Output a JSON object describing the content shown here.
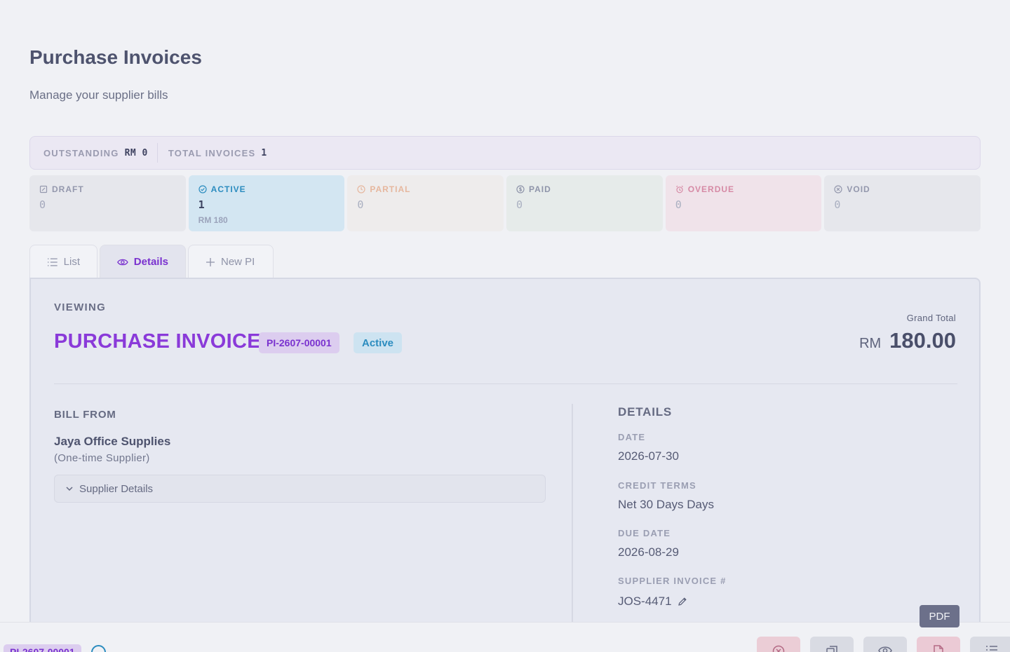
{
  "header": {
    "title": "Purchase Invoices",
    "subtitle": "Manage your supplier bills"
  },
  "summary": {
    "outstanding_label": "OUTSTANDING",
    "outstanding_value": "RM 0",
    "total_label": "TOTAL INVOICES",
    "total_value": "1"
  },
  "status_cards": [
    {
      "label": "DRAFT",
      "count": "0",
      "icon": "draft-icon"
    },
    {
      "label": "ACTIVE",
      "count": "1",
      "sub": "RM 180",
      "icon": "check-circle-icon"
    },
    {
      "label": "PARTIAL",
      "count": "0",
      "icon": "clock-icon"
    },
    {
      "label": "PAID",
      "count": "0",
      "icon": "dollar-circle-icon"
    },
    {
      "label": "OVERDUE",
      "count": "0",
      "icon": "alarm-icon"
    },
    {
      "label": "VOID",
      "count": "0",
      "icon": "x-circle-icon"
    }
  ],
  "tabs": [
    {
      "label": "List",
      "icon": "list-icon"
    },
    {
      "label": "Details",
      "icon": "eye-icon",
      "active": true
    },
    {
      "label": "New PI",
      "icon": "plus-icon"
    }
  ],
  "invoice": {
    "viewing_label": "VIEWING",
    "title": "PURCHASE INVOICE",
    "number": "PI-2607-00001",
    "status": "Active",
    "grand_total_label": "Grand Total",
    "currency": "RM",
    "grand_total": "180.00"
  },
  "bill_from": {
    "label": "BILL FROM",
    "supplier_name": "Jaya Office Supplies",
    "supplier_type": "(One-time Supplier)",
    "details_toggle": "Supplier Details"
  },
  "details": {
    "heading": "DETAILS",
    "date_label": "DATE",
    "date": "2026-07-30",
    "credit_terms_label": "CREDIT TERMS",
    "credit_terms": "Net 30 Days Days",
    "due_date_label": "DUE DATE",
    "due_date": "2026-08-29",
    "supplier_invoice_label": "SUPPLIER INVOICE #",
    "supplier_invoice": "JOS-4471"
  },
  "tooltip": {
    "pdf": "PDF"
  },
  "bottom_bar": {
    "invoice_number": "PI-2607-00001"
  },
  "colors": {
    "accent": "#8a3ad9",
    "active_blue": "#2b8cbf",
    "overdue_pink": "#d68aa5"
  }
}
